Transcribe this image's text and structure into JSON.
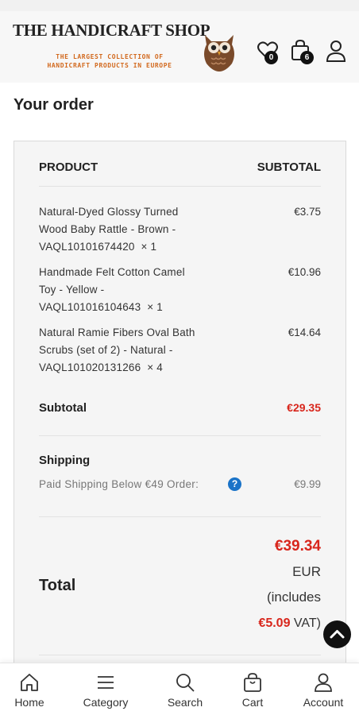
{
  "header": {
    "brand_title": "THE HANDICRAFT SHOP",
    "brand_tagline_line1": "THE LARGEST COLLECTION OF",
    "brand_tagline_line2": "HANDICRAFT PRODUCTS IN EUROPE",
    "wishlist_count": "0",
    "cart_count": "6",
    "icons": [
      "heart-icon",
      "shopping-bag-icon",
      "user-icon"
    ]
  },
  "page": {
    "title": "Your order"
  },
  "order": {
    "col_product": "PRODUCT",
    "col_subtotal": "SUBTOTAL",
    "items": [
      {
        "name_line1": "Natural-Dyed Glossy Turned",
        "name_line2": "Wood Baby Rattle - Brown -",
        "name_line3": "VAQL10101674420",
        "qty": "× 1",
        "price": "€3.75"
      },
      {
        "name_line1": "Handmade Felt Cotton Camel",
        "name_line2": "Toy - Yellow -",
        "name_line3": "VAQL101016104643",
        "qty": "× 1",
        "price": "€10.96"
      },
      {
        "name_line1": "Natural Ramie Fibers Oval Bath",
        "name_line2": "Scrubs (set of 2) - Natural -",
        "name_line3": "VAQL101020131266",
        "qty": "× 4",
        "price": "€14.64"
      }
    ],
    "subtotal_label": "Subtotal",
    "subtotal_value": "€29.35",
    "shipping_label": "Shipping",
    "shipping_method": "Paid Shipping Below €49 Order:",
    "shipping_help": "?",
    "shipping_price": "€9.99",
    "total_label": "Total",
    "total_amount": "€39.34",
    "total_currency": "EUR",
    "total_includes": "(includes",
    "vat_amount": "€5.09",
    "vat_label": "VAT)"
  },
  "bottom_nav": [
    {
      "label": "Home",
      "icon": "home-icon"
    },
    {
      "label": "Category",
      "icon": "menu-icon"
    },
    {
      "label": "Search",
      "icon": "search-icon"
    },
    {
      "label": "Cart",
      "icon": "shopping-bag-icon"
    },
    {
      "label": "Account",
      "icon": "user-icon"
    }
  ],
  "colors": {
    "accent_red": "#d8261c",
    "help_blue": "#1a73c8",
    "brand_orange": "#d2691e"
  }
}
